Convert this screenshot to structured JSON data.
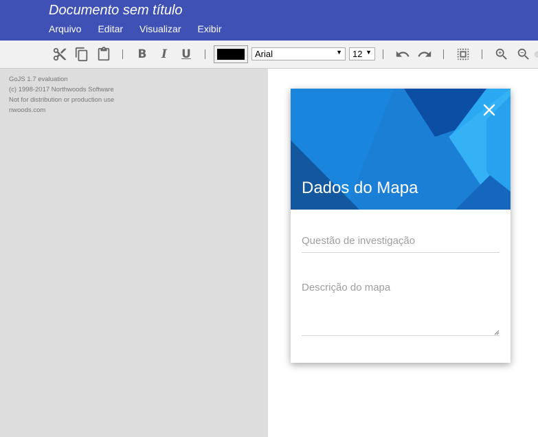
{
  "app": {
    "doc_title": "Documento sem título",
    "menu": [
      "Arquivo",
      "Editar",
      "Visualizar",
      "Exibir"
    ]
  },
  "toolbar": {
    "font_family": "Arial",
    "font_size": "12",
    "text_color": "#000000",
    "icons": [
      "cut-icon",
      "copy-icon",
      "paste-icon",
      "bold-icon",
      "italic-icon",
      "underline-icon",
      "undo-icon",
      "redo-icon",
      "select-all-icon",
      "zoom-in-icon",
      "zoom-out-icon"
    ],
    "bold_label": "B",
    "italic_label": "I",
    "underline_label": "U",
    "font_arrow": "▼"
  },
  "watermark": {
    "lines": [
      "GoJS 1.7 evaluation",
      "(c) 1998-2017 Northwoods Software",
      "Not for distribution or production use",
      "nwoods.com"
    ]
  },
  "dialog": {
    "title": "Dados do Mapa",
    "question_placeholder": "Questão de investigação",
    "description_placeholder": "Descrição do mapa",
    "close_icon": "close-icon"
  },
  "colors": {
    "app_bar": "#3f51b5",
    "toolbar": "#f1f1f1",
    "canvas_left": "#dddddd",
    "header_blue": "#1c7fd6",
    "placeholder": "#9e9e9e"
  }
}
